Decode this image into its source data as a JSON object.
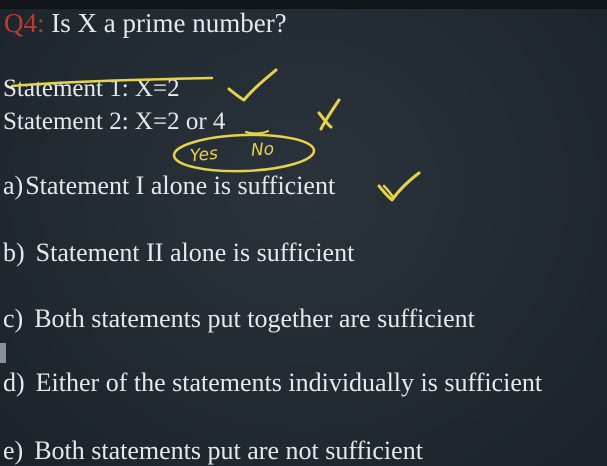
{
  "question": {
    "label": "Q4:",
    "text": "Is X a prime number?"
  },
  "statements": [
    {
      "text": "Statement 1: X=2"
    },
    {
      "text": "Statement 2: X=2 or 4"
    }
  ],
  "annotations": {
    "yes": "Yes",
    "no": "No",
    "ink_color": "#e8d24a"
  },
  "options": [
    {
      "letter": "a)",
      "text": "Statement I alone is sufficient"
    },
    {
      "letter": "b)",
      "text": "Statement II alone is sufficient"
    },
    {
      "letter": "c)",
      "text": "Both statements put together are sufficient"
    },
    {
      "letter": "d)",
      "text": "Either of the statements individually is sufficient"
    },
    {
      "letter": "e)",
      "text": "Both statements put are not sufficient"
    }
  ]
}
